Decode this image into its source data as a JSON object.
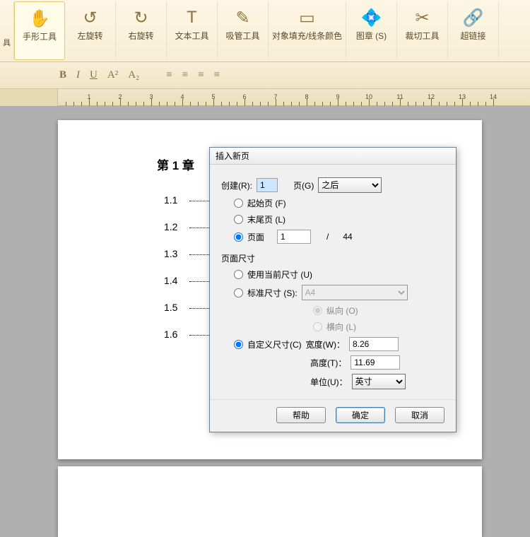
{
  "ribbon": {
    "first": "具",
    "items": [
      {
        "label": "手形工具",
        "icon": "✋"
      },
      {
        "label": "左旋转",
        "icon": "↺"
      },
      {
        "label": "右旋转",
        "icon": "↻"
      },
      {
        "label": "文本工具",
        "icon": "T"
      },
      {
        "label": "吸管工具",
        "icon": "✎"
      },
      {
        "label": "对象填充/线条颜色",
        "icon": "▭"
      },
      {
        "label": "图章 (S)",
        "icon": "💠"
      },
      {
        "label": "裁切工具",
        "icon": "✂"
      },
      {
        "label": "超链接",
        "icon": "🔗"
      }
    ]
  },
  "fmt": {
    "b": "B",
    "i": "I",
    "u": "U",
    "a2": "A²",
    "a2s": "A₂",
    "al": "≡",
    "ac": "≡",
    "ar": "≡",
    "aj": "≡"
  },
  "ruler": {
    "majors": [
      1,
      2,
      3,
      4,
      5,
      6,
      7,
      8,
      9,
      10,
      11,
      12,
      13,
      14
    ]
  },
  "doc": {
    "chapter": "第 1 章",
    "toc": [
      "1.1",
      "1.2",
      "1.3",
      "1.4",
      "1.5",
      "1.6"
    ]
  },
  "dlg": {
    "title": "插入新页",
    "create": "创建(R):",
    "create_val": "1",
    "page_g": "页(G)",
    "after": "之后",
    "start": "起始页 (F)",
    "end": "末尾页 (L)",
    "page": "页面",
    "page_val": "1",
    "slash": "/",
    "total": "44",
    "size_label": "页面尺寸",
    "use_current": "使用当前尺寸 (U)",
    "std": "标准尺寸 (S):",
    "std_val": "A4",
    "portrait": "纵向 (O)",
    "landscape": "横向 (L)",
    "custom": "自定义尺寸(C)",
    "width": "宽度(W)：",
    "width_val": "8.26",
    "height": "高度(T)：",
    "height_val": "11.69",
    "unit": "单位(U)：",
    "unit_val": "英寸",
    "help": "帮助",
    "ok": "确定",
    "cancel": "取消"
  }
}
